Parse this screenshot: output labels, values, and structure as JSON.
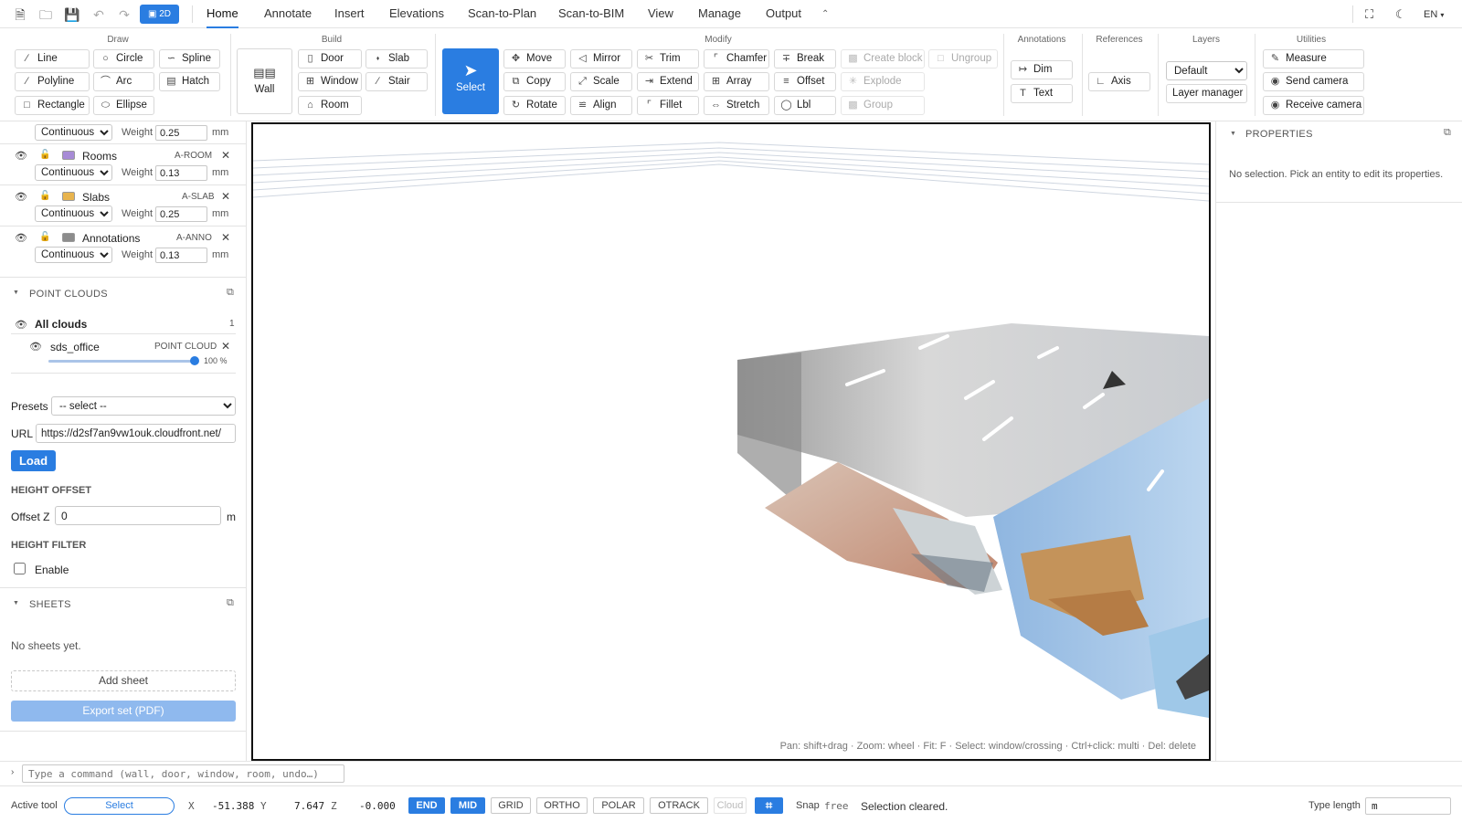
{
  "topbar": {
    "badge_2d": "2D",
    "tabs": [
      {
        "label": "Home",
        "active": true
      },
      {
        "label": "Annotate"
      },
      {
        "label": "Insert"
      },
      {
        "label": "Elevations"
      },
      {
        "label": "Scan-to-Plan"
      },
      {
        "label": "Scan-to-BIM"
      },
      {
        "label": "View"
      },
      {
        "label": "Manage"
      },
      {
        "label": "Output"
      }
    ],
    "language": "EN"
  },
  "ribbon": {
    "groups": {
      "draw": "Draw",
      "build": "Build",
      "modify": "Modify",
      "annotations": "Annotations",
      "references": "References",
      "layers": "Layers",
      "utilities": "Utilities"
    },
    "draw": [
      "Line",
      "Circle",
      "Spline",
      "Polyline",
      "Arc",
      "Hatch",
      "Rectangle",
      "Ellipse"
    ],
    "build": {
      "wall": "Wall",
      "door": "Door",
      "slab": "Slab",
      "window": "Window",
      "stair": "Stair",
      "room": "Room"
    },
    "select": "Select",
    "modify": [
      "Move",
      "Mirror",
      "Trim",
      "Chamfer",
      "Break",
      "Copy",
      "Scale",
      "Extend",
      "Array",
      "Offset",
      "Rotate",
      "Align",
      "Fillet",
      "Stretch",
      "Lbl"
    ],
    "block": {
      "create_block": "Create block",
      "ungroup": "Ungroup",
      "explode": "Explode",
      "group": "Group"
    },
    "annotations": {
      "dim": "Dim",
      "text": "Text"
    },
    "references": {
      "axis": "Axis"
    },
    "layers": {
      "selected": "Default",
      "manager": "Layer manager"
    },
    "utilities": {
      "measure": "Measure",
      "send_camera": "Send camera",
      "receive_camera": "Receive camera"
    }
  },
  "layers_panel": {
    "top_row": {
      "linetype": "Continuous",
      "weight_label": "Weight",
      "weight": "0.25",
      "unit": "mm"
    },
    "layers": [
      {
        "name": "Rooms",
        "code": "A-ROOM",
        "color": "#a78bd6",
        "linetype": "Continuous",
        "weight": "0.13"
      },
      {
        "name": "Slabs",
        "code": "A-SLAB",
        "color": "#e8b44e",
        "linetype": "Continuous",
        "weight": "0.25"
      },
      {
        "name": "Annotations",
        "code": "A-ANNO",
        "color": "#8c8c8c",
        "linetype": "Continuous",
        "weight": "0.13"
      }
    ],
    "weight_label": "Weight",
    "unit": "mm"
  },
  "point_clouds": {
    "title": "POINT CLOUDS",
    "all_label": "All clouds",
    "count": "1",
    "item": {
      "name": "sds_office",
      "type": "POINT CLOUD",
      "opacity": 100,
      "opacity_label": "100 %"
    },
    "presets_label": "Presets",
    "presets_value": "-- select --",
    "url_label": "URL",
    "url_value": "https://d2sf7an9vw1ouk.cloudfront.net/",
    "load": "Load",
    "height_offset_title": "HEIGHT OFFSET",
    "offset_label": "Offset Z",
    "offset_value": "0",
    "offset_unit": "m",
    "height_filter_title": "HEIGHT FILTER",
    "enable_label": "Enable"
  },
  "sheets": {
    "title": "SHEETS",
    "empty": "No sheets yet.",
    "add": "Add sheet",
    "export": "Export set (PDF)"
  },
  "viewport": {
    "hint": "Pan: shift+drag · Zoom: wheel · Fit: F · Select: window/crossing · Ctrl+click: multi · Del: delete"
  },
  "properties": {
    "title": "PROPERTIES",
    "empty": "No selection. Pick an entity to edit its properties."
  },
  "command": {
    "placeholder": "Type a command (wall, door, window, room, undo…)"
  },
  "status": {
    "active_tool_label": "Active tool",
    "active_tool": "Select",
    "x_label": "X",
    "x": "-51.388",
    "y_label": "Y",
    "y": "7.647",
    "z_label": "Z",
    "z": "-0.000",
    "snaps": [
      {
        "label": "END",
        "on": true
      },
      {
        "label": "MID",
        "on": true
      },
      {
        "label": "GRID",
        "on": false
      },
      {
        "label": "ORTHO",
        "on": false
      },
      {
        "label": "POLAR",
        "on": false
      },
      {
        "label": "OTRACK",
        "on": false
      },
      {
        "label": "Cloud",
        "disabled": true
      }
    ],
    "snap_label": "Snap",
    "snap_mode": "free",
    "message": "Selection cleared.",
    "type_length_label": "Type length",
    "type_length_value": "m"
  },
  "colors": {
    "accent": "#2a7de1"
  }
}
